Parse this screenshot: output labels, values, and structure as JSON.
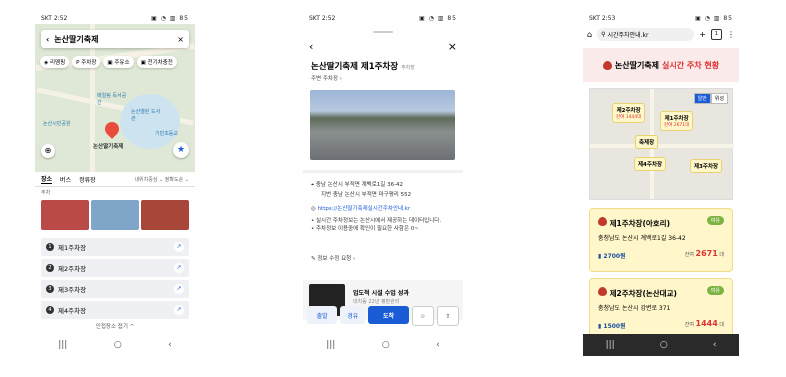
{
  "phone1": {
    "status": {
      "time": "SKT 2:52",
      "icons": "▣ ◔ ▥ 85"
    },
    "search": {
      "back": "‹",
      "query": "논산딸기축제",
      "close": "×"
    },
    "chips": [
      "◈ 리멤핑",
      "P 주차장",
      "▣ 주유소",
      "▣ 전기차충전"
    ],
    "map": {
      "pin_label": "논산딸기축제",
      "labels": [
        "논산시민공원",
        "매일림 독서공간",
        "논산열린 도서관",
        "기빈초등교"
      ]
    },
    "tabs": [
      "장소",
      "버스",
      "정류장"
    ],
    "sort": "내위치중심 ⌄   정확도순 ⌄",
    "sub": "주차",
    "items": [
      {
        "num": "1",
        "label": "제1주차장"
      },
      {
        "num": "2",
        "label": "제2주차장"
      },
      {
        "num": "3",
        "label": "제3주차장"
      },
      {
        "num": "4",
        "label": "제4주차장"
      }
    ],
    "fold": "인접장소 접기 ^"
  },
  "phone2": {
    "status": {
      "time": "SKT 2:52",
      "icons": "▣ ◔ ▥ 85"
    },
    "title": "논산딸기축제 제1주차장",
    "category": "주차장",
    "subtitle": "주변 주차장 ›",
    "address": "충남 논산시 부적면 계백로1길 36-42",
    "jibun": "지번  충남 논산시 부적면 마구평리 552",
    "link": "https://논산딸기축제실시간주차안내.kr",
    "notice1": "• 실시간 주차정보는 논산시에서 제공하는 데이터입니다.",
    "notice2": "• 주차정보 이용중에 확인이 필요한 사항은 0~",
    "edit": "정보 수정 요청 ›",
    "ad_title": "업도적 시설 수업 성과",
    "ad_sub": "대치동 22년 평판관리",
    "actions": [
      "출발",
      "경유",
      "도착",
      "☆",
      "⇧"
    ]
  },
  "phone3": {
    "status": {
      "time": "SKT 2:53",
      "icons": "▣ ◔ ▥ 85"
    },
    "browser": {
      "url": "시간주차안내.kr",
      "tabs": "1"
    },
    "header": {
      "title_black": "논산딸기축제",
      "title_red": "실시간 주차 현황"
    },
    "map_toggle": [
      "일반",
      "위성"
    ],
    "map_tips": [
      {
        "name": "제2주차장",
        "count": "잔여 1444대"
      },
      {
        "name": "제1주차장",
        "count": "잔여 2671대"
      },
      {
        "name": "축제장",
        "count": ""
      },
      {
        "name": "제4주차장",
        "count": ""
      },
      {
        "name": "제3주차장",
        "count": ""
      }
    ],
    "lots": [
      {
        "name": "제1주차장(아호리)",
        "badge": "여유",
        "address": "충청남도 논산시 계백로1길 36-42",
        "fee": "2700원",
        "avail_label": "잔여",
        "avail_num": "2671",
        "avail_unit": "대"
      },
      {
        "name": "제2주차장(논산대교)",
        "badge": "여유",
        "address": "충청남도 논산시 강변로 371",
        "fee": "1500원",
        "avail_label": "잔여",
        "avail_num": "1444",
        "avail_unit": "대"
      }
    ]
  },
  "navbar": [
    "|||",
    "○",
    "‹"
  ]
}
